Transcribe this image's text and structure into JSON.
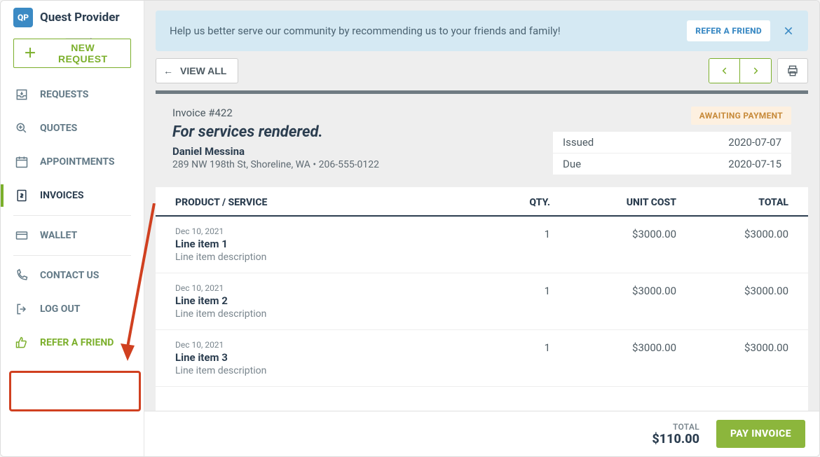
{
  "brand": {
    "logo_short": "QP",
    "name": "Quest Provider"
  },
  "sidebar": {
    "new_request": "NEW REQUEST",
    "items": [
      {
        "label": "REQUESTS",
        "icon": "inbox-download-icon"
      },
      {
        "label": "QUOTES",
        "icon": "quote-search-icon"
      },
      {
        "label": "APPOINTMENTS",
        "icon": "calendar-icon"
      },
      {
        "label": "INVOICES",
        "icon": "dollar-file-icon",
        "active": true
      },
      {
        "label": "WALLET",
        "icon": "card-icon"
      },
      {
        "label": "CONTACT US",
        "icon": "phone-icon"
      },
      {
        "label": "LOG OUT",
        "icon": "logout-icon"
      },
      {
        "label": "REFER A FRIEND",
        "icon": "thumbs-up-icon",
        "refer": true
      }
    ]
  },
  "banner": {
    "text": "Help us better serve our community by recommending us to your friends and family!",
    "cta": "REFER A FRIEND"
  },
  "toolbar": {
    "view_all": "VIEW ALL"
  },
  "invoice": {
    "number_label": "Invoice #422",
    "title": "For services rendered.",
    "customer_name": "Daniel Messina",
    "address_line": "289 NW 198th St, Shoreline, WA  •  206-555-0122",
    "status": "AWAITING PAYMENT",
    "issued_label": "Issued",
    "issued_date": "2020-07-07",
    "due_label": "Due",
    "due_date": "2020-07-15"
  },
  "table": {
    "headers": {
      "product": "PRODUCT / SERVICE",
      "qty": "QTY.",
      "unit_cost": "UNIT COST",
      "total": "TOTAL"
    },
    "items": [
      {
        "date": "Dec 10, 2021",
        "name": "Line item 1",
        "desc": "Line item description",
        "qty": "1",
        "unit_cost": "$3000.00",
        "total": "$3000.00"
      },
      {
        "date": "Dec 10, 2021",
        "name": "Line item 2",
        "desc": "Line item description",
        "qty": "1",
        "unit_cost": "$3000.00",
        "total": "$3000.00"
      },
      {
        "date": "Dec 10, 2021",
        "name": "Line item 3",
        "desc": "Line item description",
        "qty": "1",
        "unit_cost": "$3000.00",
        "total": "$3000.00"
      }
    ]
  },
  "footer": {
    "total_label": "TOTAL",
    "total_value": "$110.00",
    "pay_button": "PAY INVOICE"
  }
}
